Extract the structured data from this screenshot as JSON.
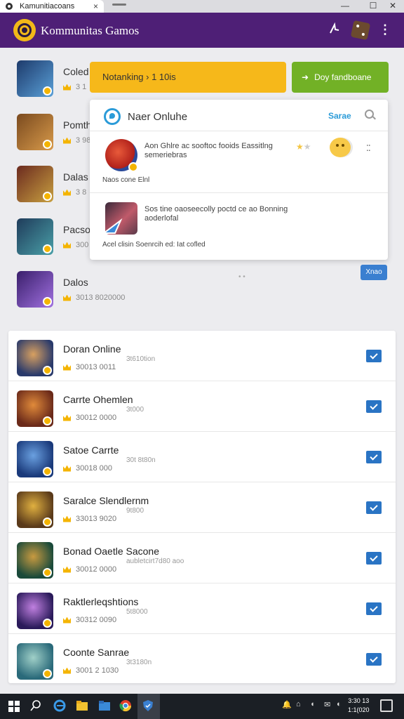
{
  "browser": {
    "tab_title": "Kamunitiacoans",
    "tab_close": "×",
    "controls": [
      "—",
      "☐",
      "✕"
    ]
  },
  "app": {
    "title": "Kommunitas  Gamos",
    "icons": [
      "share-icon",
      "dice-icon",
      "more-vertical-icon"
    ]
  },
  "background_list": [
    {
      "name": "Coled",
      "meta": "3 1",
      "colors": [
        "#1d3a6b",
        "#5aa0d8"
      ]
    },
    {
      "name": "Pomth",
      "meta": "3 98",
      "colors": [
        "#7a4a1f",
        "#d89a4a"
      ]
    },
    {
      "name": "Dalas",
      "meta": "3 8",
      "colors": [
        "#6b2a1f",
        "#c8a040"
      ]
    },
    {
      "name": "Pacso",
      "meta": "300",
      "colors": [
        "#1f3b5a",
        "#4aa0a8"
      ]
    },
    {
      "name": "Dalos",
      "meta": "3013 8020000",
      "colors": [
        "#3a1f6b",
        "#a070e0"
      ]
    }
  ],
  "actions": {
    "ranking_label": "Notanking  ›  1 10is",
    "green_label": "Doy fandboane",
    "green_arrow": "➜"
  },
  "popup": {
    "title": "Naer Onluhe",
    "search_label": "Sarae",
    "items": [
      {
        "text": "Aon Ghlre ac sooftoc fooids Eassitlng semeriebras",
        "sub": "Naos cone Elnl",
        "rating": 3
      },
      {
        "text": "Sos tine oaoseecolly poctd ce ao Bonning aoderlofal",
        "sub": "Acel clisin Soenrcih ed: Iat cofled"
      }
    ],
    "more": "⁚⁚"
  },
  "pager": "• •",
  "small_button": "Xnao",
  "list": [
    {
      "name": "Doran Online",
      "sub": "3t610tion",
      "meta": "30013 0011",
      "colors": [
        "#2a3a6b",
        "#d8a060"
      ]
    },
    {
      "name": "Carrte Ohemlen",
      "sub": "3t000",
      "meta": "30012 0000",
      "colors": [
        "#6b2a1a",
        "#e08a3a"
      ]
    },
    {
      "name": "Satoe Carrte",
      "sub": "30t 8t80n",
      "meta": "30018 000",
      "colors": [
        "#1a3a7b",
        "#6aa0e0"
      ]
    },
    {
      "name": "Saralce Slendlernm",
      "sub": "9t800",
      "meta": "33013 9020",
      "colors": [
        "#5a3a1a",
        "#e0b040"
      ]
    },
    {
      "name": "Bonad Oaetle Sacone",
      "sub": "aubletcirt7d80 aoo",
      "meta": "30012 0000",
      "colors": [
        "#1a4a3a",
        "#c89a40"
      ]
    },
    {
      "name": "Raktlerleqshtions",
      "sub": "5t8000",
      "meta": "30312 0090",
      "colors": [
        "#2a1a5a",
        "#c080e0"
      ]
    },
    {
      "name": "Coonte Sanrae",
      "sub": "3t3180n",
      "meta": "3001 2 1030",
      "colors": [
        "#2a6a7a",
        "#a0d0c8"
      ]
    }
  ],
  "taskbar": {
    "clock_line1": "3:30 13",
    "clock_line2": "1:1(020",
    "tray": [
      "🔔",
      "⌂",
      "◖",
      "✉",
      "◐"
    ]
  }
}
